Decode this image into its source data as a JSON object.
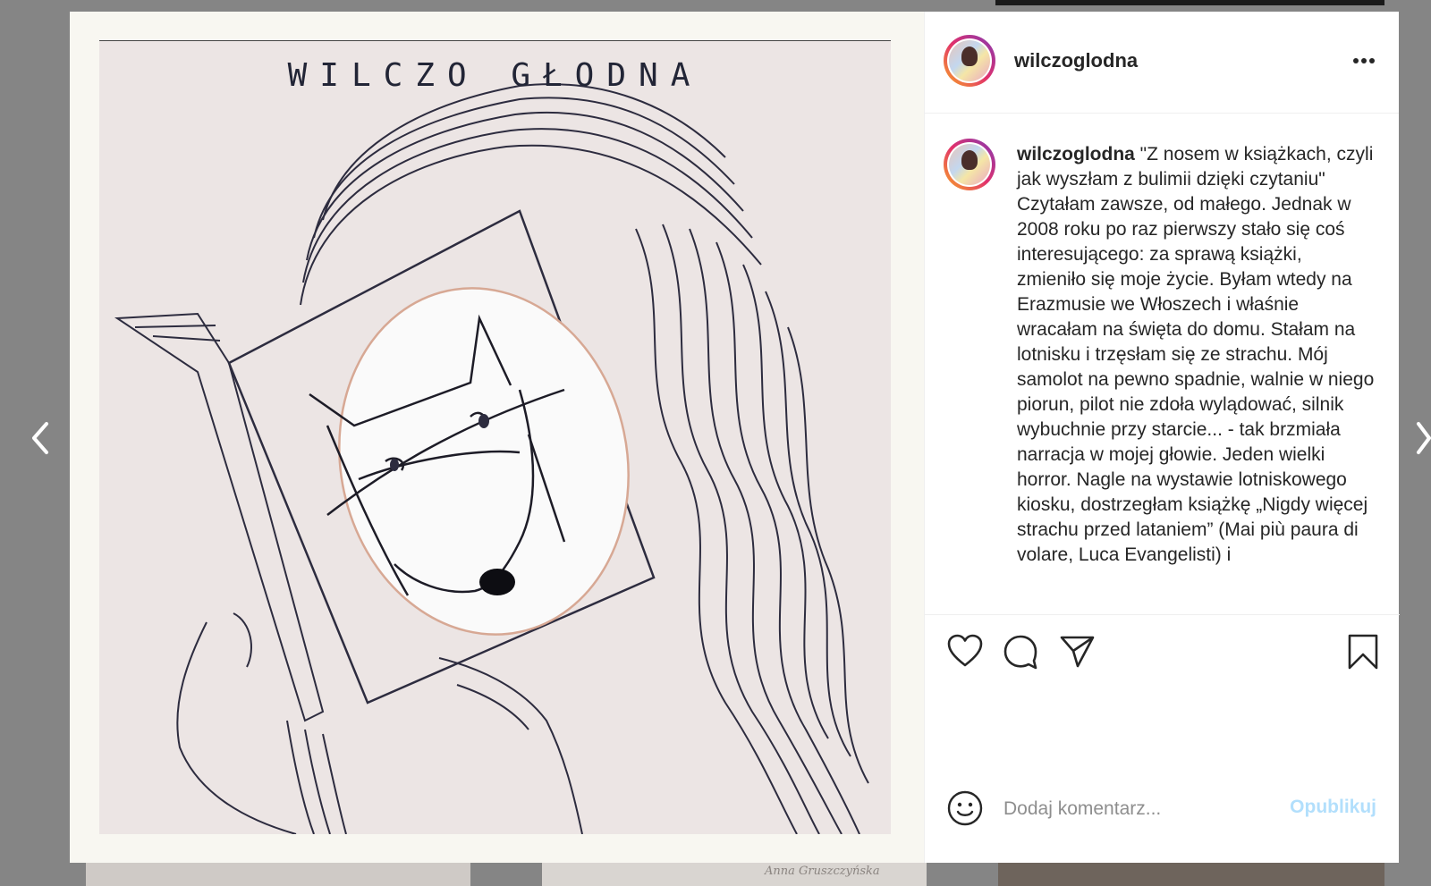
{
  "post": {
    "username": "wilczoglodna",
    "image_title": "WILCZO GŁODNA",
    "caption": {
      "username": "wilczoglodna",
      "text": " \"Z nosem w książkach, czyli jak wyszłam z bulimii dzięki czytaniu\"\nCzytałam zawsze, od małego. Jednak w 2008 roku po raz pierwszy stało się coś interesującego: za sprawą książki, zmieniło się moje życie. Byłam wtedy na Erazmusie we Włoszech i właśnie wracałam na święta do domu. Stałam na lotnisku i trzęsłam się ze strachu. Mój samolot na pewno spadnie, walnie w niego piorun, pilot nie zdoła wylądować, silnik wybuchnie przy starcie... - tak brzmiała narracja w mojej głowie. Jeden wielki horror. Nagle na wystawie lotniskowego kiosku, dostrzegłam książkę „Nigdy więcej strachu przed lataniem” (Mai più paura di volare, Luca Evangelisti) i"
    }
  },
  "comment": {
    "placeholder": "Dodaj komentarz...",
    "publish_label": "Opublikuj"
  },
  "background": {
    "signature": "Anna Gruszczyńska"
  },
  "icons": {
    "more": "more-icon",
    "like": "heart-icon",
    "comment": "comment-icon",
    "share": "paper-plane-icon",
    "save": "bookmark-icon",
    "emoji": "emoji-icon",
    "prev": "chevron-left-icon",
    "next": "chevron-right-icon"
  },
  "colors": {
    "accent": "#b2dffc",
    "text": "#262626",
    "placeholder": "#8e8e8e"
  }
}
